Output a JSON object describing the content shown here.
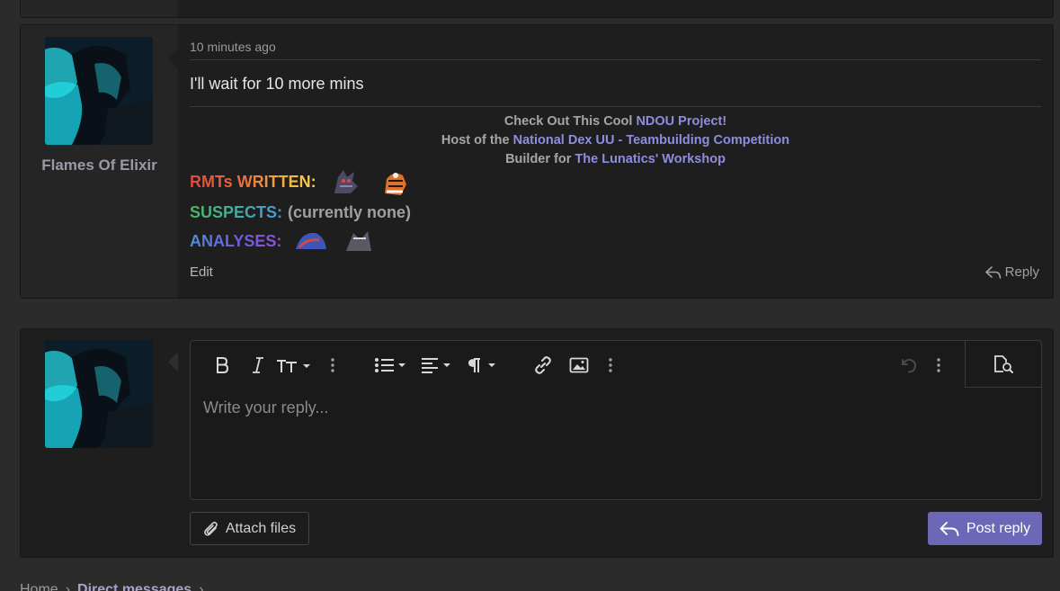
{
  "post": {
    "username": "Flames Of Elixir",
    "timestamp": "10 minutes ago",
    "message": "I'll wait for 10 more mins",
    "edit_label": "Edit",
    "reply_label": "Reply",
    "signature": {
      "line1_prefix": "Check Out This Cool ",
      "line1_link": "NDOU Project!",
      "line2_prefix": "Host of the ",
      "line2_link": "National Dex UU - Teambuilding Competition",
      "line3_prefix": "Builder for ",
      "line3_link": "The Lunatics' Workshop",
      "rmts_label": "RMTs WRITTEN:",
      "suspects_label": "SUSPECTS:",
      "suspects_value": "(currently none)",
      "analyses_label": "ANALYSES:"
    }
  },
  "reply_editor": {
    "placeholder": "Write your reply...",
    "toolbar_icons": [
      "bold-icon",
      "italic-icon",
      "text-size-icon",
      "more-icon",
      "list-icon",
      "align-icon",
      "paragraph-icon",
      "link-icon",
      "image-icon",
      "more-icon",
      "undo-icon",
      "more-icon",
      "preview-icon"
    ]
  },
  "actions": {
    "attach_label": "Attach files",
    "post_reply_label": "Post reply"
  },
  "breadcrumb": {
    "home": "Home",
    "direct_messages": "Direct messages"
  },
  "colors": {
    "page_bg": "#2b2b2b",
    "card_bg": "#1e1e1e",
    "link": "#8f8de0",
    "primary_button": "#6d67b8"
  }
}
